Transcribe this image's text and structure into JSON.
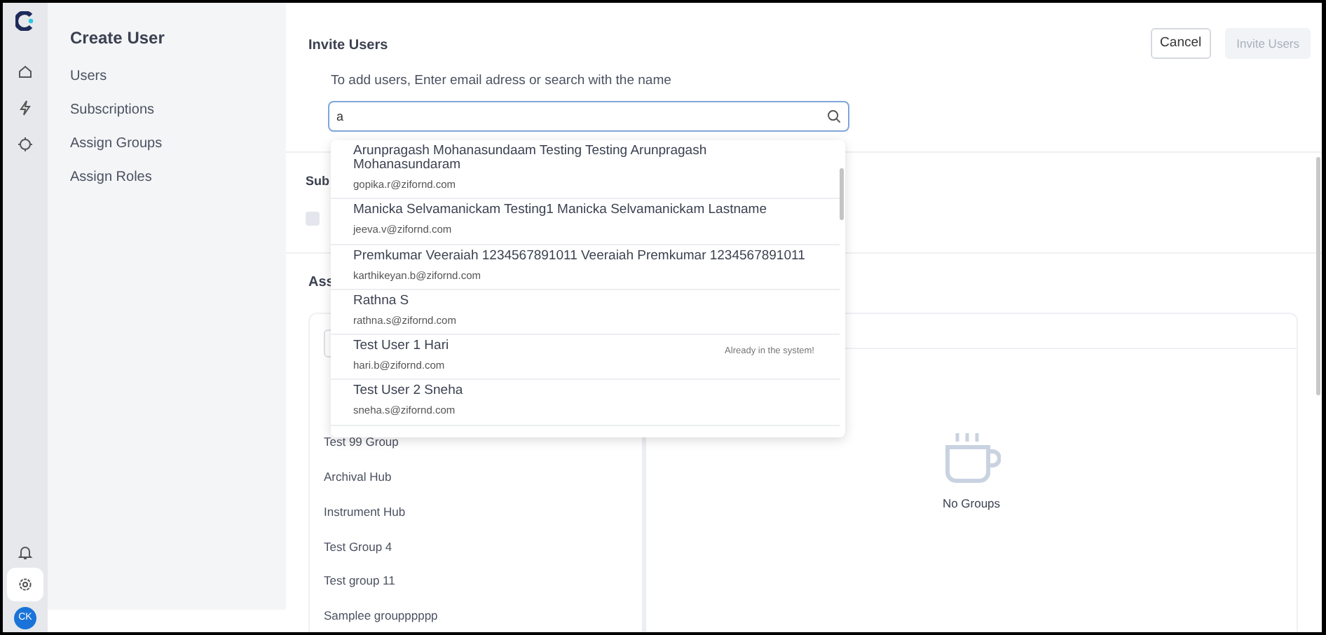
{
  "rail": {
    "top": [
      {
        "kind": "home",
        "selected": false
      },
      {
        "kind": "bolt",
        "selected": false
      },
      {
        "kind": "target",
        "selected": false
      }
    ],
    "bottom": [
      {
        "kind": "bell",
        "selected": false
      },
      {
        "kind": "settings",
        "selected": true
      }
    ],
    "avatar": "CK"
  },
  "sidebar": {
    "title": "Create User",
    "items": [
      "Users",
      "Subscriptions",
      "Assign Groups",
      "Assign Roles"
    ]
  },
  "header": {
    "title": "Invite Users",
    "buttons": [
      {
        "label": "Cancel",
        "disabled": false
      },
      {
        "label": "Invite Users",
        "disabled": true
      }
    ]
  },
  "invite": {
    "hint": "To add users, Enter email adress or search with the name",
    "search_value": "a"
  },
  "suggestions": [
    {
      "name": "Arunpragash Mohanasundaam Testing Testing Arunpragash Mohanasundaram",
      "email": "gopika.r@zifornd.com"
    },
    {
      "name": "Manicka Selvamanickam Testing1 Manicka Selvamanickam Lastname",
      "email": "jeeva.v@zifornd.com"
    },
    {
      "name": "Premkumar Veeraiah 1234567891011 Veeraiah Premkumar 1234567891011",
      "email": "karthikeyan.b@zifornd.com"
    },
    {
      "name": "Rathna S",
      "email": "rathna.s@zifornd.com"
    },
    {
      "name": "Test User 1 Hari",
      "email": "hari.b@zifornd.com",
      "note": "Already in the system!"
    },
    {
      "name": "Test User 2 Sneha",
      "email": "sneha.s@zifornd.com"
    }
  ],
  "subscriptions": {
    "title": "Sub",
    "checkbox_checked": false
  },
  "groups": {
    "title": "Ass",
    "items": [
      "Test 99 Group",
      "Archival Hub",
      "Instrument Hub",
      "Test Group 4",
      "Test group 11",
      "Samplee groupppppp"
    ],
    "empty_text": "No Groups"
  }
}
